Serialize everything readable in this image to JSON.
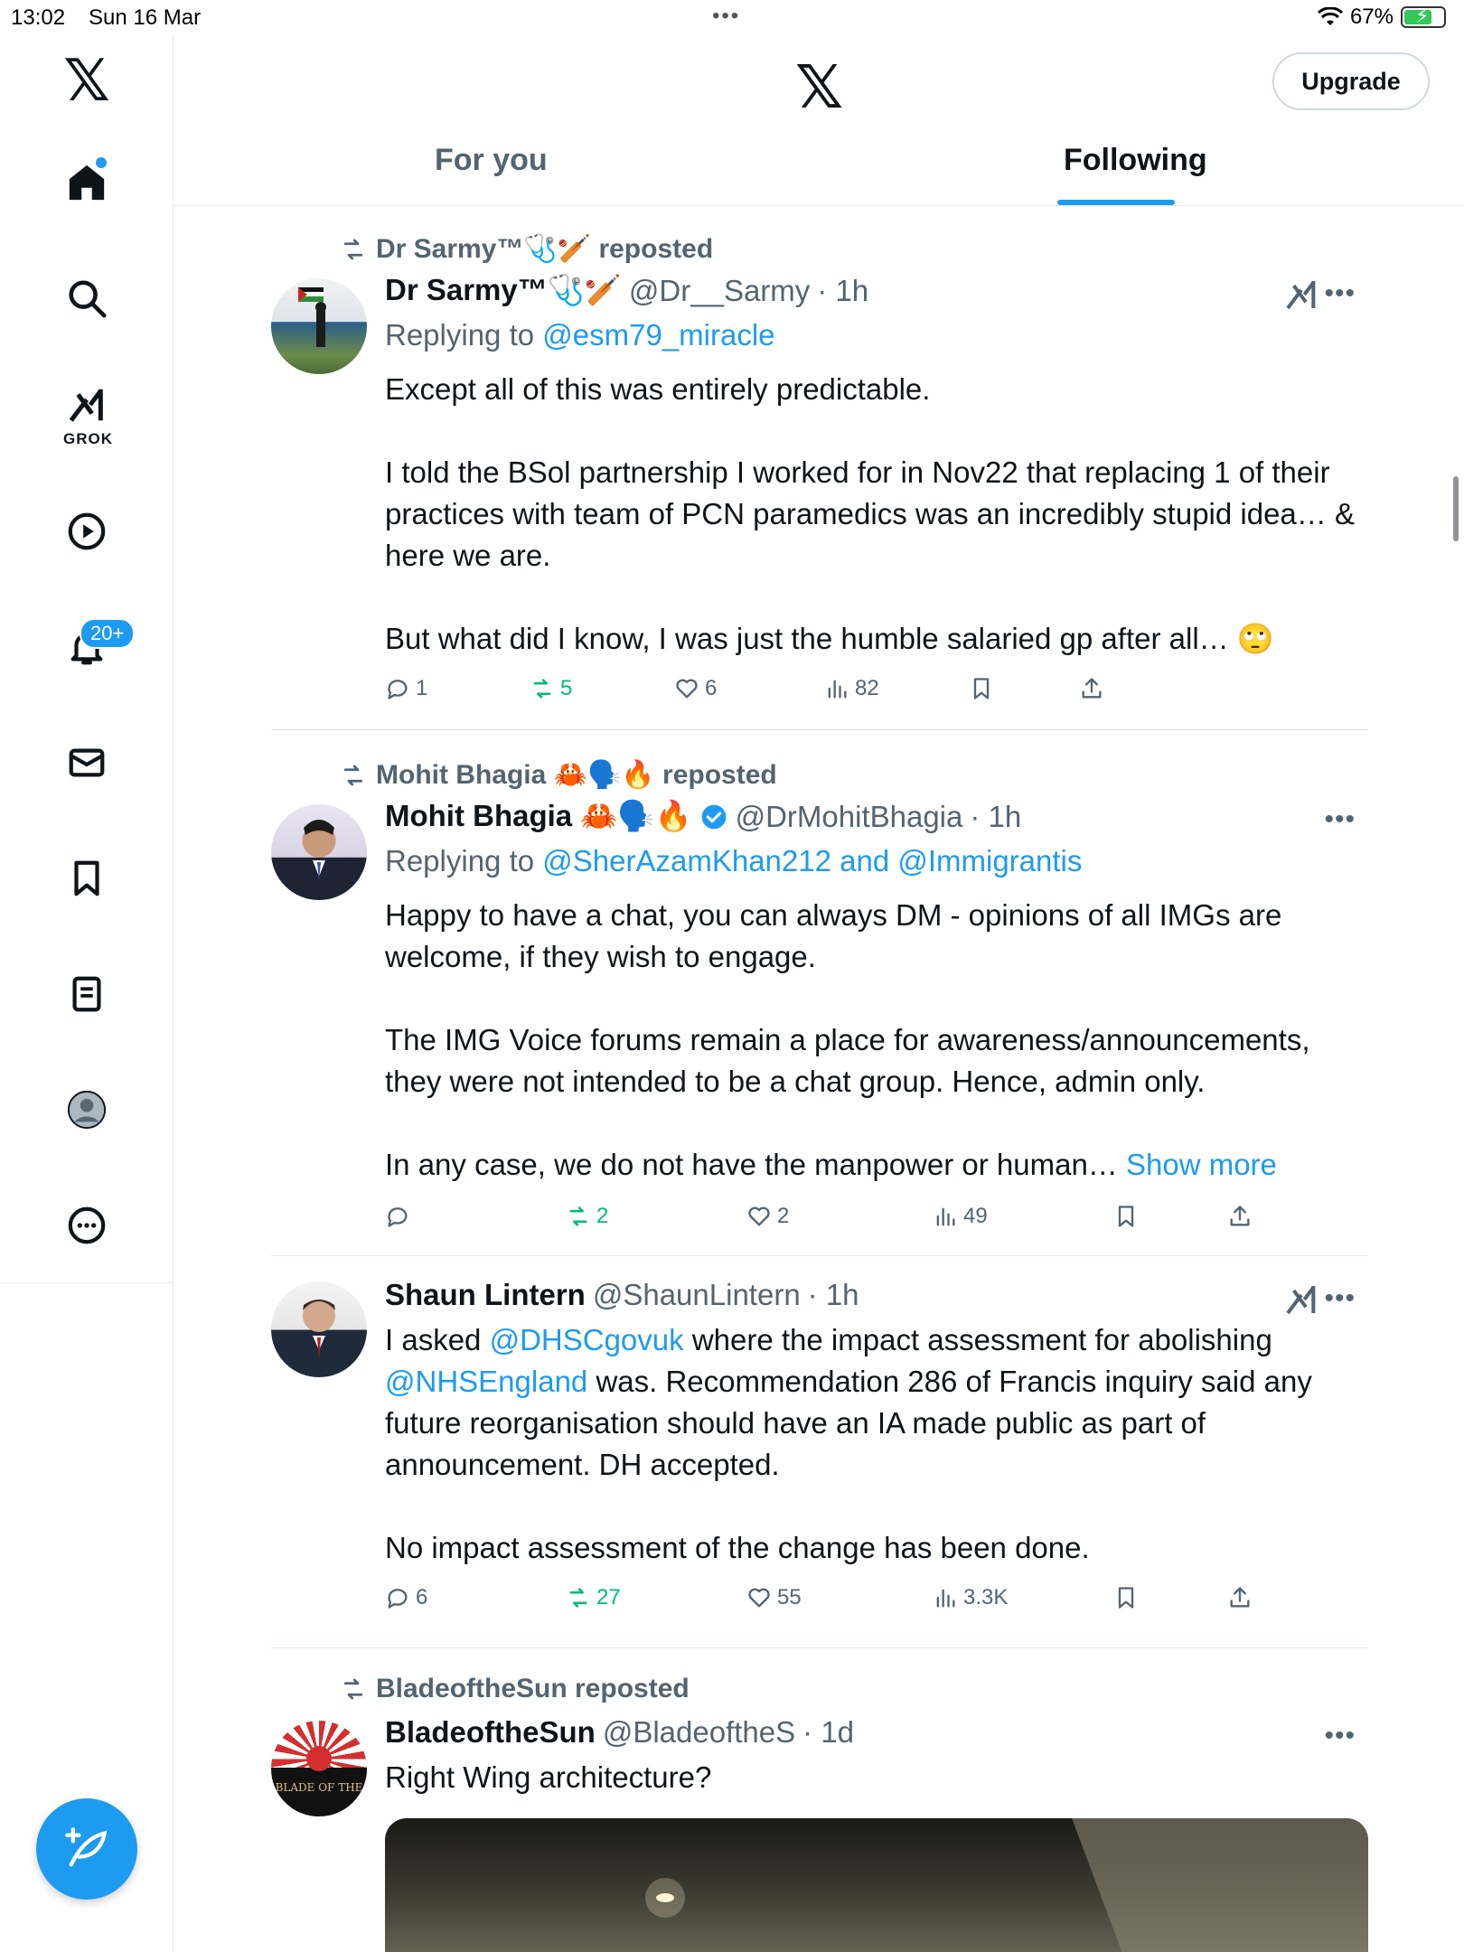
{
  "status_bar": {
    "time": "13:02",
    "date": "Sun 16 Mar",
    "battery": "67%"
  },
  "header": {
    "upgrade_label": "Upgrade",
    "tabs": [
      {
        "label": "For you"
      },
      {
        "label": "Following"
      }
    ]
  },
  "sidebar": {
    "notifications_badge": "20+",
    "grok_label": "GROK"
  },
  "posts": [
    {
      "repost_by": "Dr Sarmy™🩺🏏 reposted",
      "name": "Dr Sarmy™🩺🏏",
      "handle": "@Dr__Sarmy",
      "time": "· 1h",
      "replying_prefix": "Replying to ",
      "replying_to": "@esm79_miracle",
      "paragraphs": [
        "Except all of this was entirely predictable.",
        "I told the BSol partnership I worked for in Nov22 that replacing 1 of their practices with team of PCN paramedics was an incredibly stupid idea… & here we are.",
        "But what did I know, I was just the humble salaried gp after all… 🙄"
      ],
      "stats": {
        "replies": "1",
        "reposts": "5",
        "likes": "6",
        "views": "82"
      }
    },
    {
      "repost_by": "Mohit Bhagia 🦀🗣️🔥 reposted",
      "name": "Mohit Bhagia 🦀🗣️🔥",
      "handle": "@DrMohitBhagia",
      "time": "· 1h",
      "replying_prefix": "Replying to ",
      "replying_to": "@SherAzamKhan212 and @Immigrantis",
      "paragraphs": [
        "Happy to have a chat, you can always DM - opinions of all IMGs are welcome, if they wish to engage.",
        "The IMG Voice forums remain a place for awareness/announcements, they were not intended to be a chat group. Hence, admin only.",
        "In any case, we do not have the manpower or human… "
      ],
      "show_more": "Show more",
      "stats": {
        "replies": "",
        "reposts": "2",
        "likes": "2",
        "views": "49"
      }
    },
    {
      "name": "Shaun Lintern",
      "handle": "@ShaunLintern",
      "time": "· 1h",
      "text_parts": {
        "a": "I asked ",
        "mention1": "@DHSCgovuk",
        "b": " where the impact assessment for abolishing ",
        "mention2": "@NHSEngland",
        "c": " was. Recommendation 286 of Francis inquiry said any future reorganisation should have an IA made public as part of announcement. DH accepted."
      },
      "paragraph2": "No impact assessment of the change has been done.",
      "stats": {
        "replies": "6",
        "reposts": "27",
        "likes": "55",
        "views": "3.3K"
      }
    },
    {
      "repost_by": "BladeoftheSun reposted",
      "name": "BladeoftheSun",
      "handle": "@BladeoftheS",
      "time": "· 1d",
      "text": "Right Wing architecture?",
      "avatar_text": "BLADE OF THE"
    }
  ]
}
